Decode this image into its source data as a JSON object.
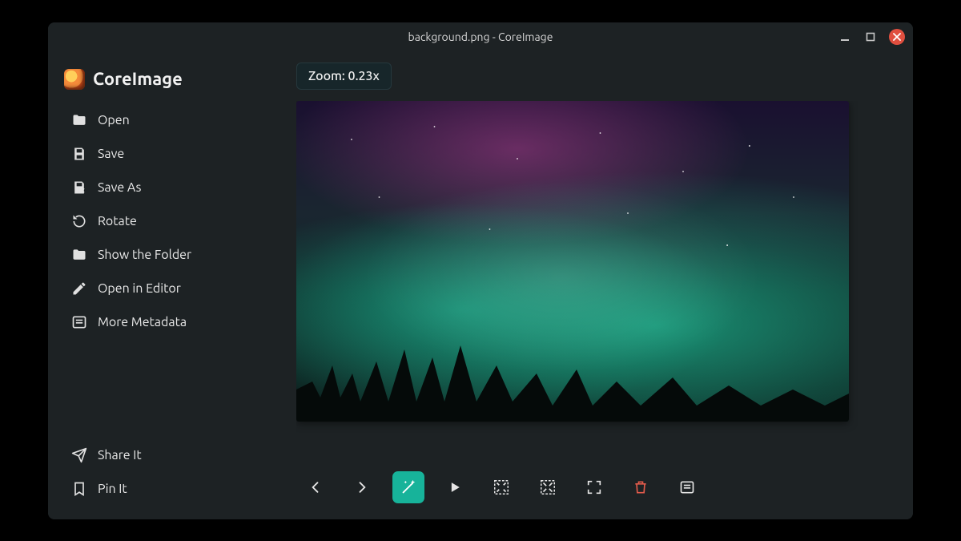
{
  "window": {
    "title": "background.png - CoreImage"
  },
  "brand": {
    "name": "CoreImage"
  },
  "sidebar": {
    "items": [
      {
        "icon": "folder-icon",
        "label": "Open"
      },
      {
        "icon": "save-icon",
        "label": "Save"
      },
      {
        "icon": "save-as-icon",
        "label": "Save As"
      },
      {
        "icon": "rotate-icon",
        "label": "Rotate"
      },
      {
        "icon": "folder-icon",
        "label": "Show the Folder"
      },
      {
        "icon": "pencil-icon",
        "label": "Open in Editor"
      },
      {
        "icon": "metadata-icon",
        "label": "More Metadata"
      }
    ],
    "bottom": [
      {
        "icon": "share-icon",
        "label": "Share It"
      },
      {
        "icon": "bookmark-icon",
        "label": "Pin It"
      }
    ]
  },
  "viewer": {
    "zoom_label": "Zoom: 0.23x",
    "zoom_value": 0.23
  },
  "toolbar": {
    "buttons": [
      {
        "name": "prev-button",
        "icon": "chevron-left-icon",
        "active": false
      },
      {
        "name": "next-button",
        "icon": "chevron-right-icon",
        "active": false
      },
      {
        "name": "magic-button",
        "icon": "wand-icon",
        "active": true
      },
      {
        "name": "play-button",
        "icon": "play-icon",
        "active": false
      },
      {
        "name": "fit-button",
        "icon": "fit-arrows-icon",
        "active": false
      },
      {
        "name": "actual-size-button",
        "icon": "grow-arrows-icon",
        "active": false
      },
      {
        "name": "fullscreen-button",
        "icon": "expand-icon",
        "active": false
      },
      {
        "name": "delete-button",
        "icon": "trash-icon",
        "active": false,
        "danger": true
      },
      {
        "name": "properties-button",
        "icon": "metadata-icon",
        "active": false
      }
    ]
  },
  "colors": {
    "accent": "#17b39a",
    "danger": "#e25b4b",
    "close": "#e04f3f",
    "bg": "#1d2224"
  }
}
